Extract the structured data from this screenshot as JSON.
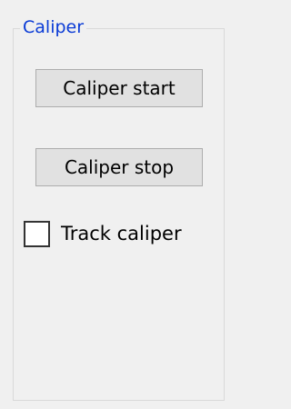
{
  "group": {
    "title": "Caliper"
  },
  "buttons": {
    "start_label": "Caliper start",
    "stop_label": "Caliper stop"
  },
  "track": {
    "label": "Track caliper",
    "checked": false
  },
  "colors": {
    "background": "#f0f0f0",
    "group_title": "#0a3bd6",
    "button_face": "#e1e1e1",
    "button_border": "#adadad"
  }
}
